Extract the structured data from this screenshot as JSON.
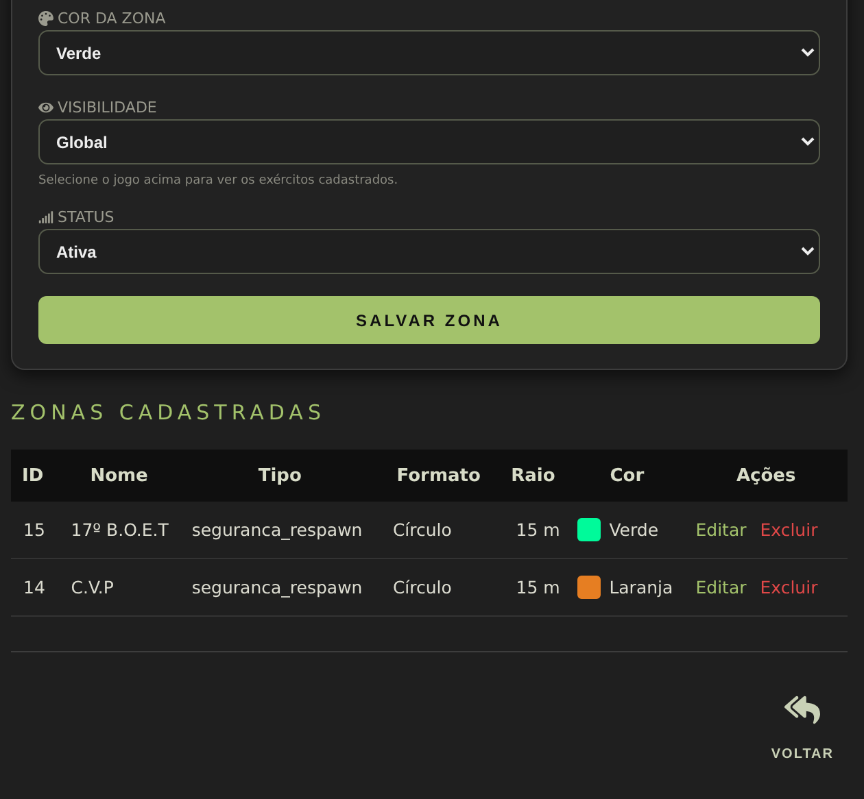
{
  "form": {
    "fields": [
      {
        "label": "COR DA ZONA",
        "value": "Verde"
      },
      {
        "label": "VISIBILIDADE",
        "value": "Global",
        "help": "Selecione o jogo acima para ver os exércitos cadastrados."
      },
      {
        "label": "STATUS",
        "value": "Ativa"
      }
    ],
    "submit": "SALVAR ZONA"
  },
  "zones": {
    "title": "ZONAS CADASTRADAS",
    "columns": [
      "ID",
      "Nome",
      "Tipo",
      "Formato",
      "Raio",
      "Cor",
      "Ações"
    ],
    "rows": [
      {
        "id": "15",
        "name": "17º B.O.E.T",
        "type": "seguranca_respawn",
        "shape": "Círculo",
        "radius": "15 m",
        "color": "#00fa9a",
        "color_name": "Verde",
        "actions": [
          "Editar",
          "Excluir"
        ]
      },
      {
        "id": "14",
        "name": "C.V.P",
        "type": "seguranca_respawn",
        "shape": "Círculo",
        "radius": "15 m",
        "color": "#e67e22",
        "color_name": "Laranja",
        "actions": [
          "Editar",
          "Excluir"
        ]
      }
    ]
  },
  "back": {
    "label": "VOLTAR"
  }
}
